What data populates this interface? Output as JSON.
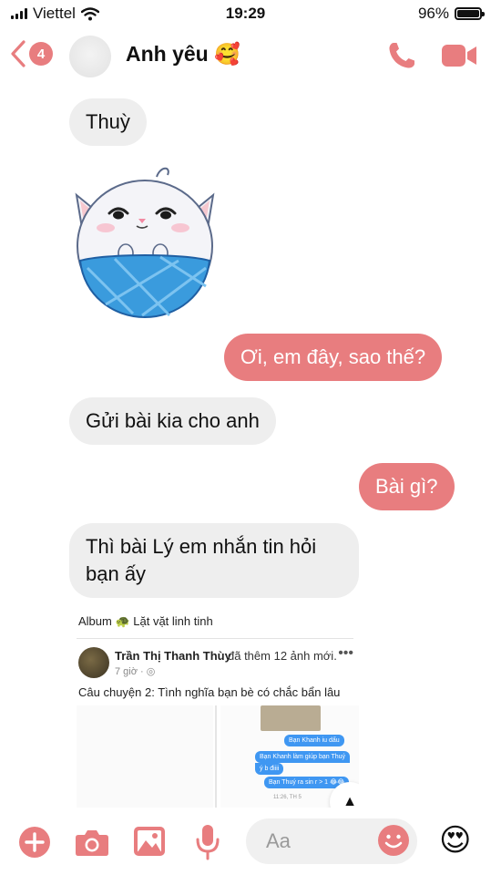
{
  "status_bar": {
    "carrier": "Viettel",
    "time": "19:29",
    "battery": "96%",
    "battery_level": 0.96
  },
  "header": {
    "back_badge": "4",
    "title": "Anh yêu 🥰"
  },
  "messages": [
    {
      "side": "in",
      "text": "Thuỳ"
    },
    {
      "side": "in",
      "type": "sticker",
      "sticker": "hamster-sticker"
    },
    {
      "side": "out",
      "text": "Ơi, em đây, sao thế?"
    },
    {
      "side": "in",
      "text": "Gửi bài kia cho anh"
    },
    {
      "side": "out",
      "text": "Bài gì?"
    },
    {
      "side": "in",
      "text": "Thì bài Lý em nhắn tin hỏi bạn ấy"
    }
  ],
  "shared_post": {
    "album_label": "Album 🐢 Lặt vặt linh tinh",
    "author": "Trần Thị Thanh Thùy",
    "action": "đã thêm 12 ảnh mới.",
    "time": "7 giờ ·",
    "caption": "Câu chuyện 2: Tình nghĩa bạn bè có chắc bẩn lâu",
    "chat": [
      "Bạn Khanh iu dấu",
      "Bạn Khanh làm giúp bạn Thuý",
      "ý b điiii",
      "Bạn Thuý ra sin r > 1 😂😂"
    ],
    "chat_time": "11:26, TH 5"
  },
  "toolbar": {
    "input_placeholder": "Aa",
    "reaction_emoji": "😍"
  },
  "colors": {
    "accent": "#e87d7f",
    "incoming_bubble": "#eeeeee",
    "chat_blue": "#3f97f2"
  }
}
